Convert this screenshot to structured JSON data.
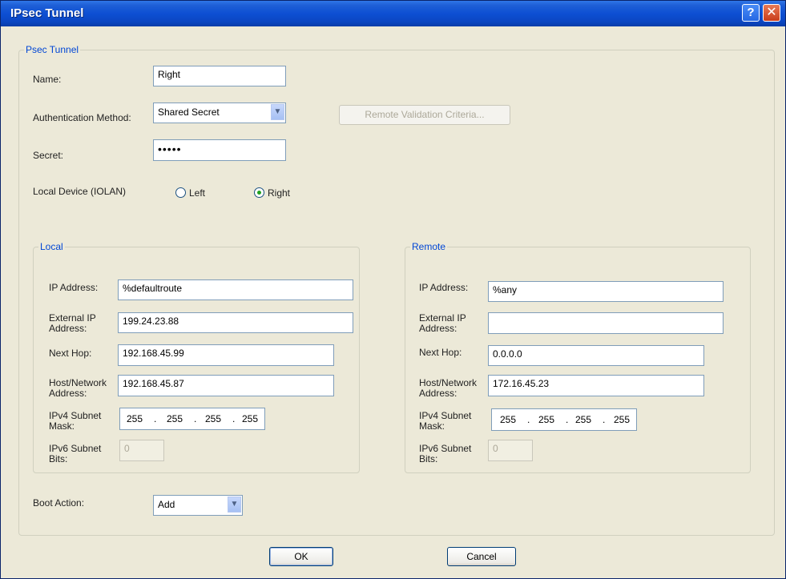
{
  "window": {
    "title": "IPsec Tunnel",
    "help_glyph": "?",
    "close_glyph": "✕"
  },
  "main": {
    "legend": "Psec Tunnel",
    "name": {
      "label": "Name:",
      "value": "Right"
    },
    "auth": {
      "label": "Authentication Method:",
      "value": "Shared Secret"
    },
    "remote_validation_button": "Remote Validation Criteria...",
    "secret": {
      "label": "Secret:",
      "value": "•••••"
    },
    "local_device": {
      "label": "Local Device (IOLAN)",
      "option_left": "Left",
      "option_right": "Right",
      "selected": "Right"
    }
  },
  "local": {
    "legend": "Local",
    "ip_address": {
      "label": "IP Address:",
      "value": "%defaultroute"
    },
    "external_ip": {
      "label_1": "External IP",
      "label_2": "Address:",
      "value": "199.24.23.88"
    },
    "next_hop": {
      "label": "Next Hop:",
      "value": "192.168.45.99"
    },
    "host_network": {
      "label_1": "Host/Network",
      "label_2": "Address:",
      "value": "192.168.45.87"
    },
    "ipv4_mask": {
      "label_1": "IPv4 Subnet",
      "label_2": "Mask:",
      "octets": [
        "255",
        "255",
        "255",
        "255"
      ]
    },
    "ipv6_bits": {
      "label_1": "IPv6 Subnet",
      "label_2": "Bits:",
      "value": "0"
    }
  },
  "remote": {
    "legend": "Remote",
    "ip_address": {
      "label": "IP Address:",
      "value": "%any"
    },
    "external_ip": {
      "label_1": "External IP",
      "label_2": "Address:",
      "value": ""
    },
    "next_hop": {
      "label": "Next Hop:",
      "value": "0.0.0.0"
    },
    "host_network": {
      "label_1": "Host/Network",
      "label_2": "Address:",
      "value": "172.16.45.23"
    },
    "ipv4_mask": {
      "label_1": "IPv4 Subnet",
      "label_2": "Mask:",
      "octets": [
        "255",
        "255",
        "255",
        "255"
      ]
    },
    "ipv6_bits": {
      "label_1": "IPv6 Subnet",
      "label_2": "Bits:",
      "value": "0"
    }
  },
  "boot_action": {
    "label": "Boot Action:",
    "value": "Add"
  },
  "buttons": {
    "ok": "OK",
    "cancel": "Cancel"
  },
  "dot": "."
}
